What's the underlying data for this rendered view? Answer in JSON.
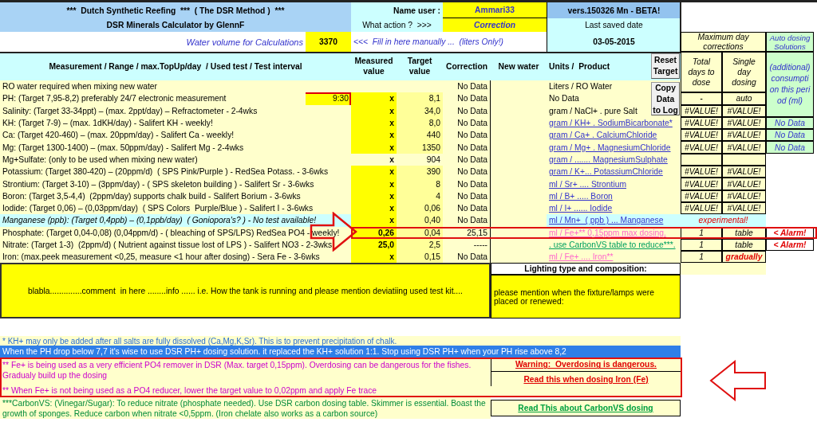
{
  "header": {
    "title": "***  Dutch Synthetic Reefing  ***  ( The DSR Method )  ***",
    "subtitle": "DSR Minerals Calculator by GlennF",
    "user_label": "Name user :",
    "user": "Ammari33",
    "version": "vers.150326 Mn - BETA!",
    "action_label": "What action ?  >>>",
    "action": "Correction",
    "saved_label": "Last saved date",
    "saved_date": "03-05-2015",
    "volume_label": "Water volume for Calculations",
    "volume": "3370",
    "volume_hint": "<<<  Fill in here manually ...  (liters Only!)"
  },
  "dosing_header": {
    "title": "Maximum day corrections",
    "total_days": "Total days to dose",
    "single_day": "Single day dosing"
  },
  "auto_header": {
    "title": "Auto dosing Solutions",
    "note": "(additional) consumption this period (ml)"
  },
  "columns": [
    "Measurement / Range / max.TopUp/day  / Used test / Test interval",
    "Measured value",
    "Target value",
    "Correction",
    "New water",
    "Units /  Product"
  ],
  "buttons": [
    {
      "label": "Reset Target"
    },
    {
      "label": "Copy Data to Log"
    }
  ],
  "rows": [
    {
      "kind": "standard",
      "measurement": "RO water required when mixing new water",
      "measured_input": false,
      "correction": "No Data",
      "unit": {
        "kind": "plain",
        "text": "Liters / RO Water"
      },
      "highlighted": false
    },
    {
      "kind": "standard",
      "measurement": "PH: (Target 7,95-8,2) preferably 24/7 electronic measurement",
      "time": "9:30",
      "measured": "x",
      "measured_input": true,
      "target": "8,1",
      "correction": "No Data",
      "unit": {
        "kind": "plain",
        "text": "No Data"
      },
      "dosing": {
        "kind": "values",
        "total_days": "-",
        "single_day": "auto",
        "emphasis": false
      },
      "highlighted": false
    },
    {
      "kind": "standard",
      "measurement": "Salinity: (Target 33-34ppt) – (max. 2ppt/day) – Refractometer - 2-4wks",
      "measured": "x",
      "measured_input": true,
      "target": "34,0",
      "correction": "No Data",
      "unit": {
        "kind": "plain",
        "text": "gram / NaCl+ . pure Salt"
      },
      "dosing": {
        "kind": "values",
        "total_days": "#VALUE!",
        "single_day": "#VALUE!",
        "emphasis": false
      },
      "highlighted": false
    },
    {
      "kind": "standard",
      "measurement": "KH: (Target 7-9) – (max. 1dKH/day) - Salifert KH - weekly!",
      "measured": "x",
      "measured_input": true,
      "target": "8,0",
      "correction": "No Data",
      "unit": {
        "kind": "link",
        "text": "gram / KH+ . SodiumBicarbonate*"
      },
      "dosing": {
        "kind": "values",
        "total_days": "#VALUE!",
        "single_day": "#VALUE!",
        "emphasis": false
      },
      "auto": {
        "kind": "value",
        "text": "No Data"
      },
      "highlighted": false
    },
    {
      "kind": "standard",
      "measurement": "Ca: (Target 420-460) – (max. 20ppm/day) - Salifert Ca - weekly!",
      "measured": "x",
      "measured_input": true,
      "target": "440",
      "correction": "No Data",
      "unit": {
        "kind": "link",
        "text": "gram / Ca+ . CalciumChloride"
      },
      "dosing": {
        "kind": "values",
        "total_days": "#VALUE!",
        "single_day": "#VALUE!",
        "emphasis": false
      },
      "auto": {
        "kind": "value",
        "text": "No Data"
      },
      "highlighted": false
    },
    {
      "kind": "standard",
      "measurement": "Mg: (Target 1300-1400) – (max. 50ppm/day) - Salifert Mg - 2-4wks",
      "measured": "x",
      "measured_input": true,
      "target": "1350",
      "correction": "No Data",
      "unit": {
        "kind": "link",
        "text": "gram / Mg+ . MagnesiumChloride"
      },
      "dosing": {
        "kind": "values",
        "total_days": "#VALUE!",
        "single_day": "#VALUE!",
        "emphasis": false
      },
      "auto": {
        "kind": "value",
        "text": "No Data"
      },
      "highlighted": false
    },
    {
      "kind": "standard",
      "measurement": "Mg+Sulfate: (only to be used when mixing new water)",
      "measured": "x",
      "measured_input": false,
      "target": "904",
      "correction": "No Data",
      "unit": {
        "kind": "link",
        "text": "gram / ....... MagnesiumSulphate"
      },
      "dosing": {
        "kind": "empty"
      },
      "highlighted": false
    },
    {
      "kind": "standard",
      "measurement": "Potassium: (Target 380-420) – (20ppm/d)  ( SPS Pink/Purple ) - RedSea Potass. - 3-6wks",
      "measured": "x",
      "measured_input": true,
      "target": "390",
      "correction": "No Data",
      "unit": {
        "kind": "link",
        "text": "gram / K+... PotassiumChloride"
      },
      "dosing": {
        "kind": "values",
        "total_days": "#VALUE!",
        "single_day": "#VALUE!",
        "emphasis": false
      },
      "highlighted": false
    },
    {
      "kind": "standard",
      "measurement": "Strontium: (Target 3-10) – (3ppm/day) - ( SPS skeleton building ) - Salifert Sr - 3-6wks",
      "measured": "x",
      "measured_input": true,
      "target": "8",
      "correction": "No Data",
      "unit": {
        "kind": "link",
        "text": "ml / Sr+ .... Strontium"
      },
      "dosing": {
        "kind": "values",
        "total_days": "#VALUE!",
        "single_day": "#VALUE!",
        "emphasis": false
      },
      "highlighted": false
    },
    {
      "kind": "standard",
      "measurement": "Boron: (Target 3,5-4,4)  (2ppm/day) supports chalk build - Salifert Borium - 3-6wks",
      "measured": "x",
      "measured_input": true,
      "target": "4",
      "correction": "No Data",
      "unit": {
        "kind": "link",
        "text": "ml / B+ ..... Boron"
      },
      "dosing": {
        "kind": "values",
        "total_days": "#VALUE!",
        "single_day": "#VALUE!",
        "emphasis": false
      },
      "highlighted": false
    },
    {
      "kind": "standard",
      "measurement": "Iodide: (Target 0,06) – (0,03ppm/day)  ( SPS Colors  Purple/Blue ) - Salifert I - 3-6wks",
      "measured": "x",
      "measured_input": true,
      "target": "0,06",
      "correction": "No Data",
      "unit": {
        "kind": "link",
        "text": "ml / I+ ...... Iodide"
      },
      "dosing": {
        "kind": "values",
        "total_days": "#VALUE!",
        "single_day": "#VALUE!",
        "emphasis": false
      },
      "highlighted": false
    },
    {
      "kind": "experimental",
      "measurement": "Manganese (ppb): (Target 0,4ppb) – (0,1ppb/day)  ( Goniopora's? ) - No test available!",
      "measured": "x",
      "measured_input": true,
      "target": "0,40",
      "correction": "No Data",
      "unit": {
        "kind": "link",
        "text": "ml / Mn+  ( ppb ) ... Manganese"
      },
      "dosing": {
        "kind": "note",
        "text": "experimental!"
      },
      "highlighted": false
    },
    {
      "kind": "standard",
      "measurement": "Phosphate: (Target 0,04-0,08) (0,04ppm/d) - ( bleaching of SPS/LPS) RedSea PO4 - weekly!",
      "measured": "0,26",
      "measured_input": true,
      "target": "0,04",
      "correction": "25,15",
      "unit": {
        "kind": "iron",
        "text": "ml / Fe+** 0,15ppm max dosing."
      },
      "dosing": {
        "kind": "values",
        "total_days": "1",
        "single_day": "table",
        "emphasis": false
      },
      "auto": {
        "kind": "alarm",
        "text": "< Alarm!"
      },
      "highlighted": true
    },
    {
      "kind": "standard",
      "measurement": "Nitrate: (Target 1-3)  (2ppm/d) ( Nutrient against tissue lost of LPS ) - Salifert NO3 - 2-3wks",
      "measured": "25,0",
      "measured_input": true,
      "target": "2,5",
      "correction": "-----",
      "unit": {
        "kind": "carbon",
        "text": ". use CarbonVS table to reduce***."
      },
      "dosing": {
        "kind": "values",
        "total_days": "1",
        "single_day": "table",
        "emphasis": false
      },
      "auto": {
        "kind": "alarm",
        "text": "< Alarm!"
      },
      "highlighted": false
    },
    {
      "kind": "standard",
      "measurement": "Iron: (max.peek measurement <0,25, measure <1 hour after dosing) - Sera Fe - 3-6wks",
      "measured": "x",
      "measured_input": true,
      "target": "0,15",
      "correction": "No Data",
      "unit": {
        "kind": "iron",
        "text": "ml / Fe+ .... Iron**"
      },
      "dosing": {
        "kind": "values",
        "total_days": "1",
        "single_day": "gradually",
        "emphasis": true
      },
      "highlighted": false
    }
  ],
  "comment": "blabla..............comment  in here ........info ...... i.e. How the tank is running and please mention deviatiing used test kit....",
  "lighting": {
    "title": "Lighting type and composition:",
    "text": "please mention when the fixture/lamps were placed or renewed:"
  },
  "notes": [
    {
      "kind": "info",
      "text": "* KH+ may only be added after all salts are fully dissolved (Ca,Mg,K,Sr). This is to prevent precipitation of chalk."
    },
    {
      "kind": "banner",
      "text": "When the PH drop below 7,7 it's wise to use DSR PH+ dosing solution. it replaced the KH+ solution 1:1. Stop using DSR PH+ when your PH rise above 8,2"
    },
    {
      "kind": "iron",
      "lines": [
        "** Fe+ is being used as a very efficient PO4 remover in DSR (Max. target 0,15ppm). Overdosing can be dangerous for the fishes. Gradualy build up the dosing",
        "** When Fe+ is not being used as a PO4 reducer, lower the target value to 0,02ppm and apply Fe trace"
      ],
      "warning": "Warning:  Overdosing is dangerous.",
      "link": "Read this when dosing Iron (Fe)",
      "highlighted": true
    },
    {
      "kind": "carbon",
      "text": "***CarbonVS: (Vinegar/Sugar): To reduce nitrate (phosphate needed). Use DSR carbon dosing table. Skimmer is essential. Boast the growth of sponges.  Reduce carbon when nitrate <0,5ppm. (Iron chelate also works as a carbon source)",
      "link": "Read This about CarbonVS dosing"
    }
  ]
}
